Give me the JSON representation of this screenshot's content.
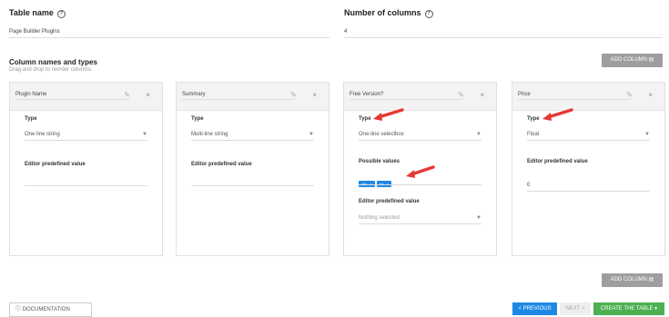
{
  "table_name": {
    "label": "Table name",
    "value": "Page Builder Plugins"
  },
  "num_columns": {
    "label": "Number of columns",
    "value": "4"
  },
  "columns_section": {
    "title": "Column names and types",
    "subtitle": "Drag and drop to reorder columns."
  },
  "add_column_label": "ADD COLUMN",
  "columns": [
    {
      "name": "Plugin Name",
      "type_label": "Type",
      "type": "One line string",
      "editor_label": "Editor predefined value",
      "editor_value": ""
    },
    {
      "name": "Summary",
      "type_label": "Type",
      "type": "Multi-line string",
      "editor_label": "Editor predefined value",
      "editor_value": ""
    },
    {
      "name": "Free Version?",
      "type_label": "Type",
      "type": "One-line selectbox",
      "possible_label": "Possible values",
      "possible_values": [
        "Yes",
        "No"
      ],
      "editor_label": "Editor predefined value",
      "editor_value": "Nothing selected"
    },
    {
      "name": "Price",
      "type_label": "Type",
      "type": "Float",
      "editor_label": "Editor predefined value",
      "editor_value": "0"
    }
  ],
  "footer": {
    "documentation": "DOCUMENTATION",
    "previous": "< PREVIOUS",
    "next": "NEXT >",
    "create": "CREATE THE TABLE ▾"
  },
  "colors": {
    "accent_blue": "#1e88e5",
    "green": "#4caf50",
    "grey_button": "#9e9e9e",
    "arrow_red": "#e53935"
  }
}
